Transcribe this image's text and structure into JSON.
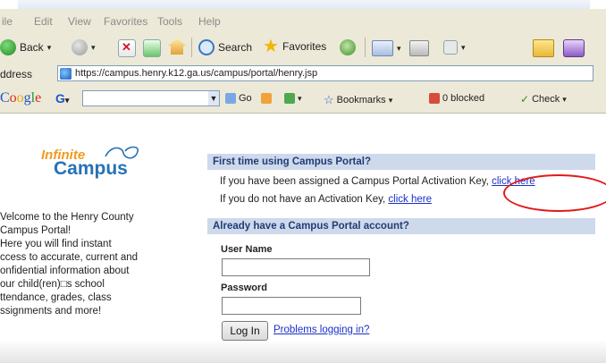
{
  "menu": [
    "ile",
    "Edit",
    "View",
    "Favorites",
    "Tools",
    "Help"
  ],
  "toolbar": {
    "back_label": "Back",
    "search_label": "Search",
    "favorites_label": "Favorites"
  },
  "address": {
    "label": "ddress",
    "url": "https://campus.henry.k12.ga.us/campus/portal/henry.jsp"
  },
  "google_bar": {
    "logo_letters": [
      "o",
      "o",
      "g",
      "l",
      "e"
    ],
    "logo_prefix": "C",
    "g_button": "G",
    "go_label": "Go",
    "bookmarks_label": "Bookmarks",
    "blocked_label": "0 blocked",
    "check_label": "Check"
  },
  "logo": {
    "infinite": "Infinite",
    "campus": "Campus"
  },
  "welcome": {
    "lines": [
      "Velcome to the Henry County",
      "Campus Portal!",
      "Here you will find instant",
      "ccess to accurate, current and",
      "onfidential information about",
      "our child(ren)□s school",
      "ttendance, grades, class",
      "ssignments and more!"
    ]
  },
  "first_time": {
    "heading": "First time using Campus Portal?",
    "line1_text": "If you have been assigned a Campus Portal Activation Key,",
    "line1_link": "click here",
    "line2_text": "If you do not have an Activation Key,",
    "line2_link": "click here"
  },
  "account": {
    "heading": "Already have a Campus Portal account?",
    "username_label": "User Name",
    "password_label": "Password",
    "login_button": "Log In",
    "problems_link": "Problems logging in?"
  },
  "colors": {
    "section_bar": "#cfd9ec",
    "link": "#1a30c8",
    "annotation": "#e11b1b",
    "logo_orange": "#f29a1f",
    "logo_blue": "#2672b6"
  }
}
